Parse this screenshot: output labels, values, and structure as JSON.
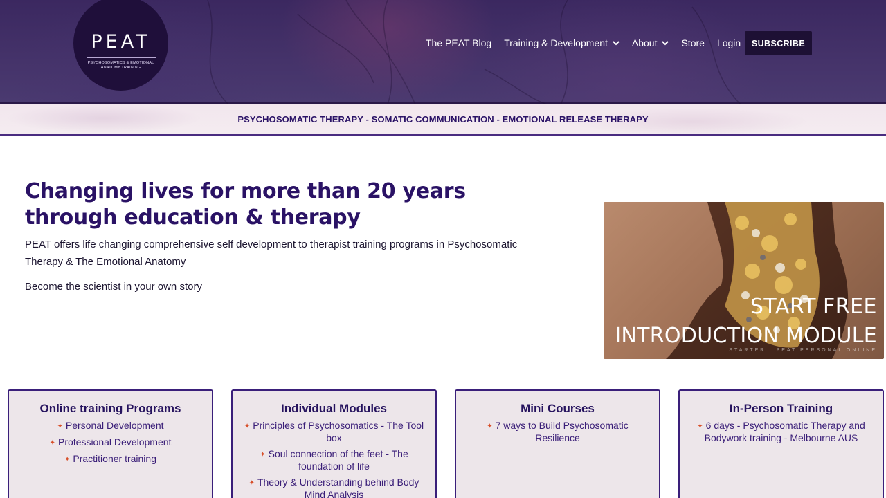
{
  "header": {
    "logo": {
      "word": "PEAT",
      "subtitle": "PSYCHOSOMATICS & EMOTIONAL ANATOMY TRAINING"
    },
    "nav": [
      {
        "label": "The PEAT Blog",
        "dropdown": false
      },
      {
        "label": "Training & Development",
        "dropdown": true
      },
      {
        "label": "About",
        "dropdown": true
      },
      {
        "label": "Store",
        "dropdown": false
      },
      {
        "label": "Login",
        "dropdown": false
      }
    ],
    "subscribe_label": "SUBSCRIBE"
  },
  "banner": {
    "text": "PSYCHOSOMATIC THERAPY - SOMATIC COMMUNICATION - EMOTIONAL RELEASE THERAPY"
  },
  "hero": {
    "title": "Changing lives for more than 20 years through education & therapy",
    "description": "PEAT offers life changing comprehensive self development to therapist training programs in Psychosomatic Therapy & The Emotional Anatomy",
    "tagline": "Become the scientist in your own story"
  },
  "promo": {
    "line1": "START FREE",
    "line2": "INTRODUCTION MODULE",
    "small": "STARTER · PEAT PERSONAL ONLINE"
  },
  "cards": [
    {
      "title": "Online training Programs",
      "items": [
        "Personal Development",
        "Professional Development",
        "Practitioner training"
      ]
    },
    {
      "title": "Individual Modules",
      "items": [
        "Principles of Psychosomatics - The Tool box",
        "Soul connection of the feet - The foundation of life",
        "Theory & Understanding behind Body Mind Analysis"
      ]
    },
    {
      "title": "Mini Courses",
      "items": [
        "7 ways to Build Psychosomatic Resilience"
      ]
    },
    {
      "title": "In-Person Training",
      "items": [
        "6 days - Psychosomatic Therapy and Bodywork training - Melbourne AUS"
      ]
    }
  ],
  "colors": {
    "header_bg": "#3b2860",
    "brand_purple": "#2a1265",
    "subscribe_bg": "#1d1034",
    "card_bg": "#ede6ea",
    "card_border": "#3a1f7a",
    "bullet": "#d8502a"
  }
}
